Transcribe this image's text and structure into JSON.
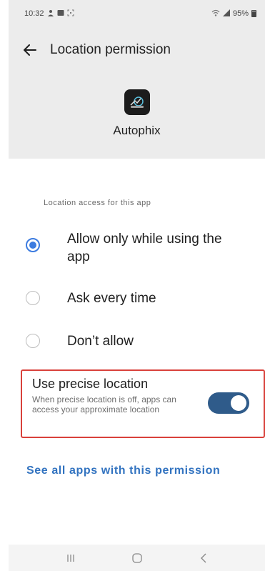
{
  "status_bar": {
    "time": "10:32",
    "battery": "95%"
  },
  "app_bar": {
    "title": "Location permission"
  },
  "app": {
    "name": "Autophix"
  },
  "section": {
    "label": "Location access for this app"
  },
  "options": [
    {
      "label": "Allow only while using the app",
      "selected": true
    },
    {
      "label": "Ask every time",
      "selected": false
    },
    {
      "label": "Don’t allow",
      "selected": false
    }
  ],
  "precise_location": {
    "title": "Use precise location",
    "description": "When precise location is off, apps can access your approximate location",
    "enabled": true
  },
  "see_all": {
    "label": "See all apps with this permission"
  },
  "colors": {
    "accent": "#3d7ce0",
    "link": "#3273c0",
    "highlight_border": "#d9413b",
    "toggle_on": "#2f5b8a"
  }
}
